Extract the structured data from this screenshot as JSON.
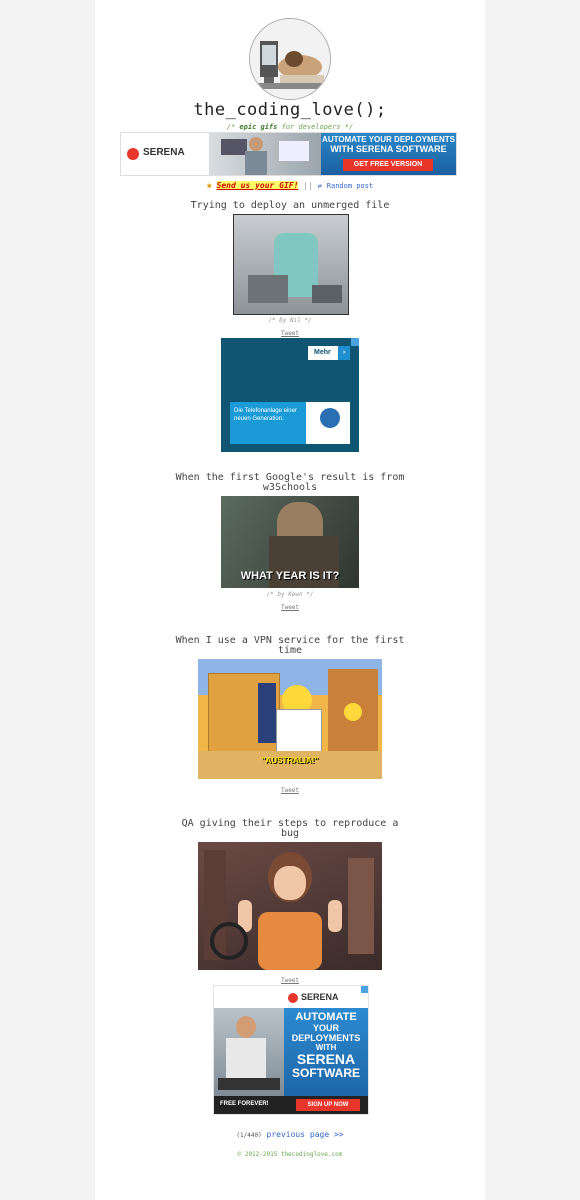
{
  "header": {
    "site_title": "the_coding_love();",
    "tagline_prefix": "/* ",
    "tagline_highlight": "epic gifs",
    "tagline_suffix": " for developers */"
  },
  "top_banner": {
    "brand": "SERENA",
    "headline_line1": "AUTOMATE YOUR DEPLOYMENTS",
    "headline_line2": "WITH SERENA SOFTWARE",
    "cta": "GET FREE VERSION"
  },
  "links": {
    "send_gif": "Send us your GIF!",
    "separator": "||",
    "random_post": "Random post"
  },
  "posts": [
    {
      "title": "Trying to deploy an unmerged file",
      "byline": "/* by Nil */",
      "tweet": "Tweet"
    },
    {
      "title": "When the first Google's result is from w3Schools",
      "caption": "WHAT YEAR IS IT?",
      "byline": "/* by Kewn */",
      "tweet": "Tweet"
    },
    {
      "title": "When I use a VPN service for the first time",
      "caption": "\"AUSTRALIA!\"",
      "tweet": "Tweet"
    },
    {
      "title": "QA giving their steps to reproduce a bug",
      "tweet": "Tweet"
    }
  ],
  "side_ad": {
    "button": "Mehr",
    "text": "Die Telefonanlage einer neuen Generation."
  },
  "bottom_ad": {
    "brand": "SERENA",
    "line1": "AUTOMATE",
    "line2": "YOUR",
    "line3": "DEPLOYMENTS",
    "line4": "WITH",
    "line5": "SERENA",
    "line6": "SOFTWARE",
    "left_cta": "FREE FOREVER!",
    "right_cta": "SIGN UP NOW"
  },
  "pagination": {
    "counter": "(1/440)",
    "next": "previous page >>"
  },
  "footer": {
    "copyright": "© 2012-2015 thecodinglove.com"
  },
  "colors": {
    "accent_green": "#6aa84f",
    "link_blue": "#3366cc",
    "serena_red": "#e8362b"
  }
}
